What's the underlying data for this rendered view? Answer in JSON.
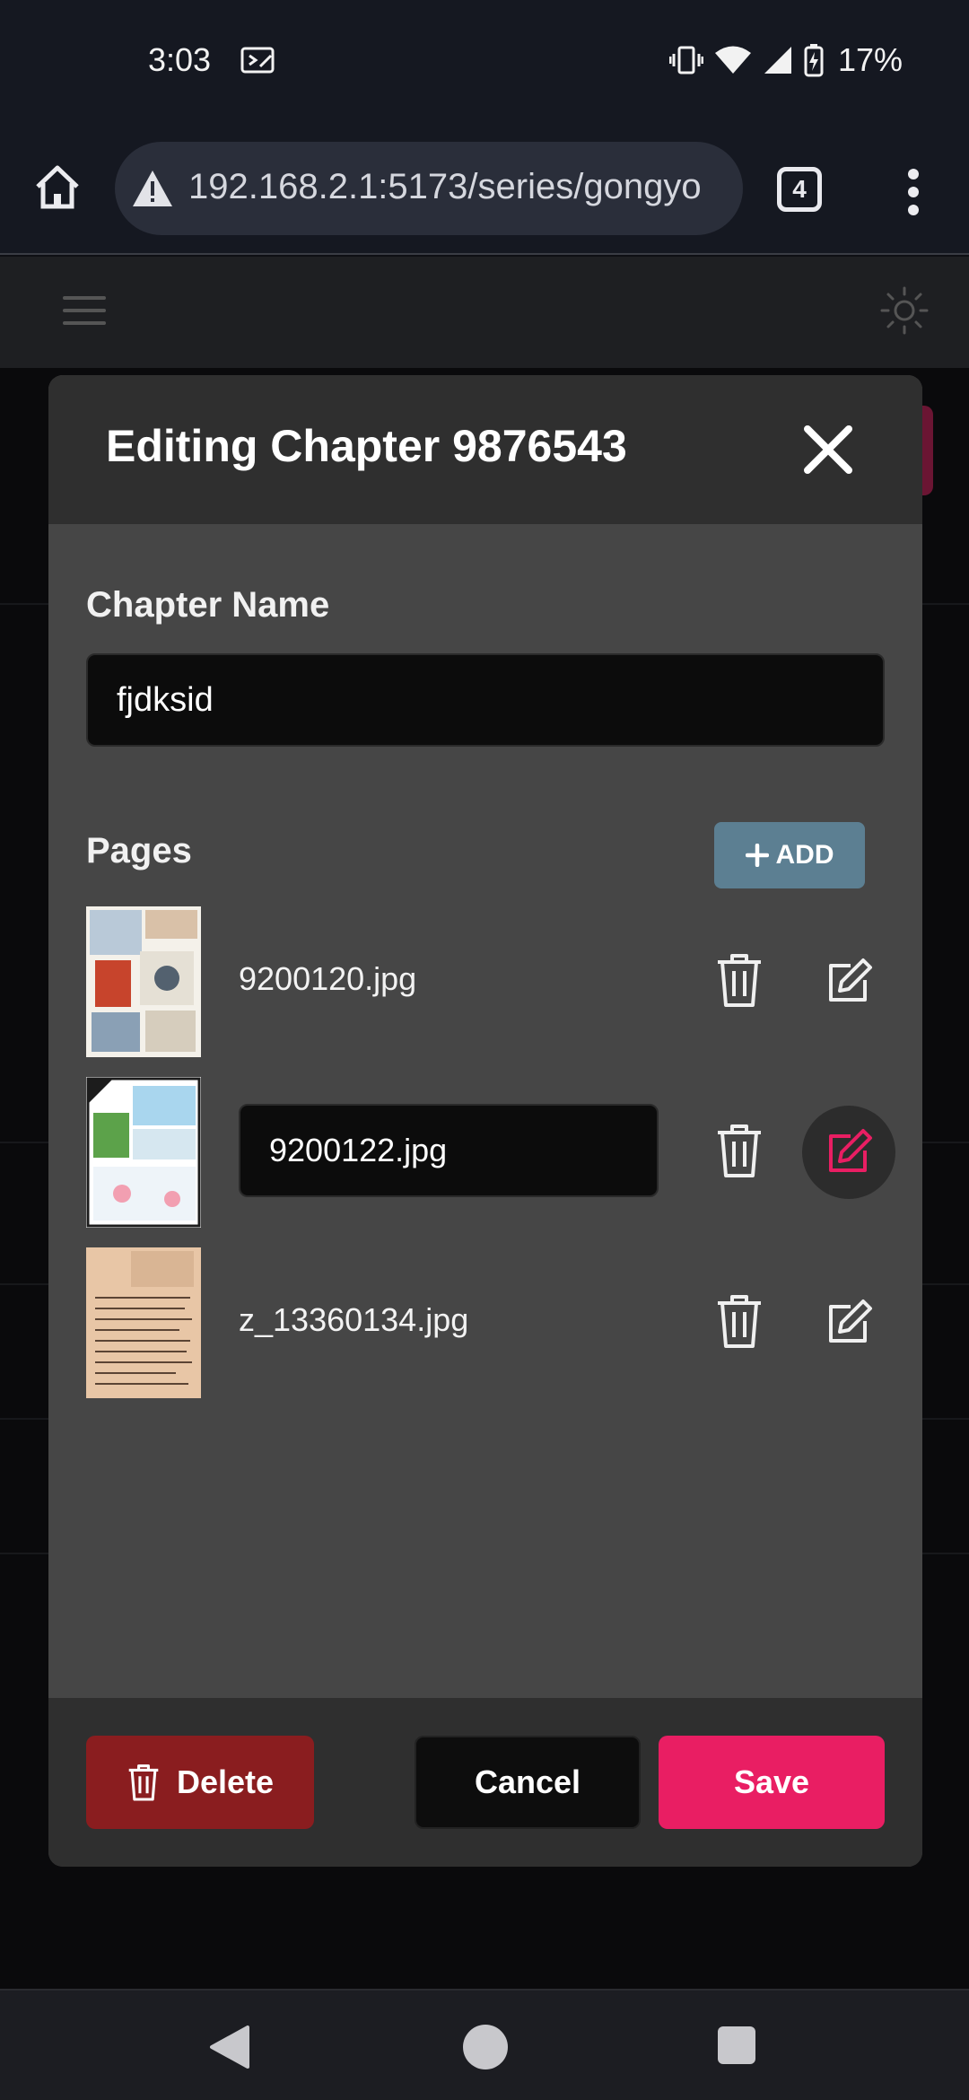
{
  "status_bar": {
    "time": "3:03",
    "battery": "17%"
  },
  "browser": {
    "url": "192.168.2.1:5173/series/gongyo",
    "tab_count": "4"
  },
  "modal": {
    "title": "Editing Chapter 9876543",
    "chapter_name_label": "Chapter Name",
    "chapter_name_value": "fjdksid",
    "pages_label": "Pages",
    "add_label": "ADD",
    "pages": [
      {
        "name": "9200120.jpg",
        "editing": false
      },
      {
        "name": "9200122.jpg",
        "editing": true
      },
      {
        "name": "z_13360134.jpg",
        "editing": false
      }
    ],
    "footer": {
      "delete_label": "Delete",
      "cancel_label": "Cancel",
      "save_label": "Save"
    }
  },
  "colors": {
    "accent": "#e91e63",
    "delete": "#8a1d1f",
    "add": "#5c7f92"
  },
  "icons": [
    "home-icon",
    "warning-icon",
    "tabs-icon",
    "more-vert-icon",
    "hamburger-icon",
    "sun-icon",
    "close-icon",
    "plus-icon",
    "trash-icon",
    "edit-icon"
  ]
}
